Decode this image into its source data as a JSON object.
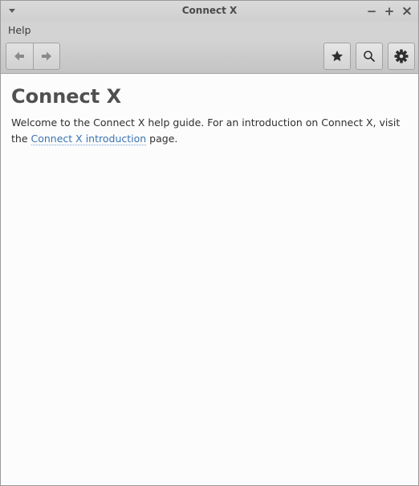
{
  "window": {
    "title": "Connect X",
    "controls": {
      "minimize": "−",
      "maximize": "+",
      "close": "×"
    }
  },
  "menubar": {
    "items": [
      "Help"
    ]
  },
  "toolbar": {
    "back_icon": "arrow-left-icon",
    "forward_icon": "arrow-right-icon",
    "bookmark_icon": "star-icon",
    "search_icon": "search-icon",
    "settings_icon": "gear-icon"
  },
  "page": {
    "title": "Connect X",
    "intro_before": "Welcome to the Connect X help guide. For an introduction on Connect X, visit the ",
    "intro_link": "Connect X introduction",
    "intro_after": " page."
  },
  "colors": {
    "link": "#3a74b4",
    "heading": "#505050"
  }
}
